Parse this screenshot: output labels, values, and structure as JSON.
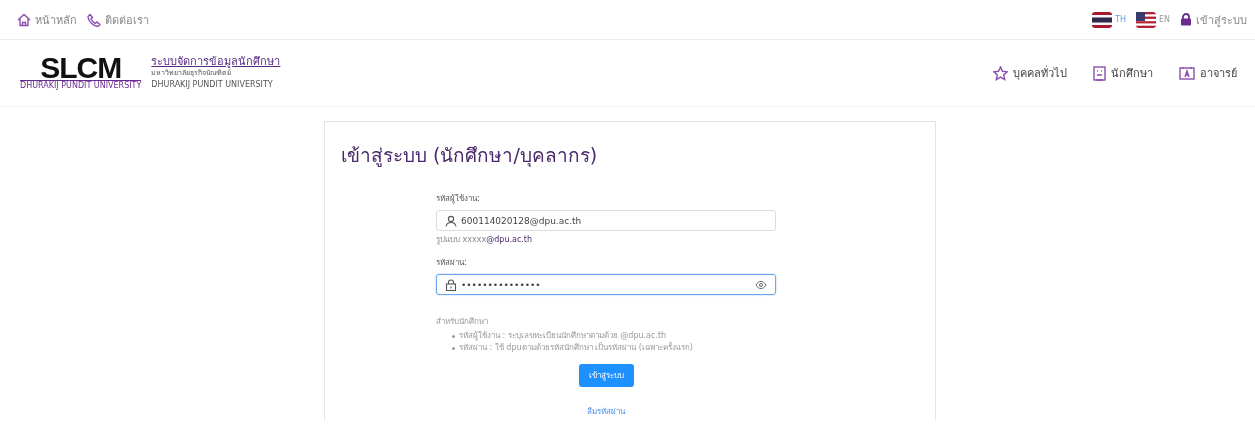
{
  "top_bar": {
    "links": [
      {
        "kind": "home",
        "label": "หน้าหลัก"
      },
      {
        "kind": "phone",
        "label": "ติดต่อเรา"
      }
    ],
    "languages": [
      {
        "kind": "th",
        "label": "TH",
        "selected": true
      },
      {
        "kind": "en",
        "label": "EN",
        "selected": false
      }
    ],
    "login_link": "เข้าสู่ระบบ"
  },
  "header": {
    "logo": {
      "mark": "SLCM",
      "caption": "DHURAKIJ PUNDIT UNIVERSITY"
    },
    "title": "ระบบจัดการข้อมูลนักศึกษา",
    "subtitle": "มหาวิทยาลัยธุรกิจบัณฑิตย์",
    "subtitle_en": "DHURAKIJ PUNDIT UNIVERSITY",
    "nav": [
      {
        "kind": "star",
        "label": "บุคคลทั่วไป"
      },
      {
        "kind": "student",
        "label": "นักศึกษา"
      },
      {
        "kind": "teacher",
        "label": "อาจารย์"
      }
    ]
  },
  "login": {
    "title": "เข้าสู่ระบบ (นักศึกษา/บุคลากร)",
    "fields": [
      {
        "kind": "user",
        "label": "รหัสผู้ใช้งาน:",
        "value": "600114020128@dpu.ac.th",
        "focused": false,
        "hint": "รูปแบบ xxxxx**@dpu.ac.th**"
      },
      {
        "kind": "password",
        "label": "รหัสผ่าน:",
        "value": "•••••••••••••••",
        "focused": true
      }
    ],
    "note_title": "สำหรับนักศึกษา",
    "notes": [
      "รหัสผู้ใช้งาน : ระบุเลขทะเบียนนักศึกษาตามด้วย @dpu.ac.th",
      "รหัสผ่าน : ใช้ dpuตามด้วยรหัสนักศึกษา เป็นรหัสผ่าน (เฉพาะครั้งแรก)"
    ],
    "submit": "เข้าสู่ระบบ",
    "forgot": "ลืมรหัสผ่าน"
  }
}
